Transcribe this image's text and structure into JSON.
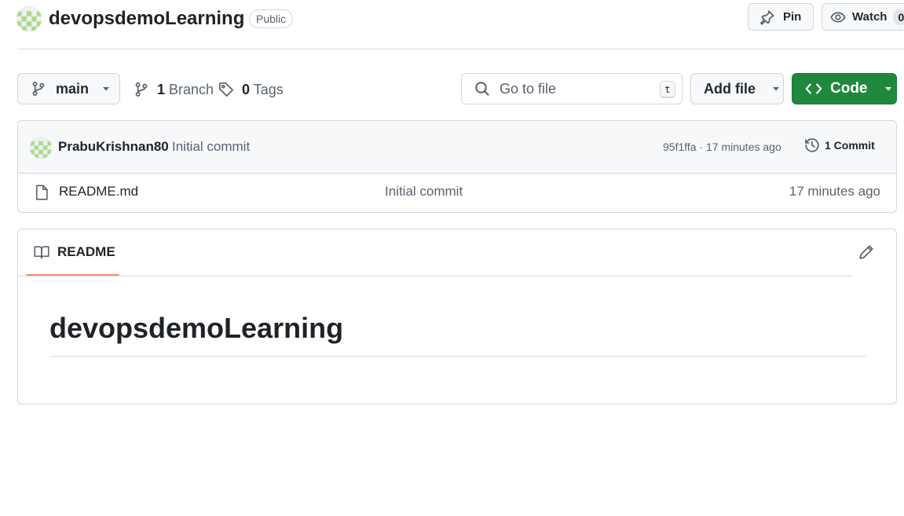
{
  "header": {
    "repo_name": "devopsdemoLearning",
    "visibility": "Public",
    "pin_label": "Pin",
    "watch_label": "Watch",
    "watch_count": "0"
  },
  "toolbar": {
    "branch_name": "main",
    "branches_count": "1",
    "branches_label": "Branch",
    "tags_count": "0",
    "tags_label": "Tags",
    "search_placeholder": "Go to file",
    "search_shortcut": "t",
    "add_file_label": "Add file",
    "code_label": "Code"
  },
  "latest_commit": {
    "author": "PrabuKrishnan80",
    "message": "Initial commit",
    "hash_and_time": "95f1ffa · 17 minutes ago",
    "commits_label": "1 Commit"
  },
  "files": [
    {
      "name": "README.md",
      "commit_message": "Initial commit",
      "age": "17 minutes ago"
    }
  ],
  "readme": {
    "tab_label": "README",
    "heading": "devopsdemoLearning"
  },
  "colors": {
    "code_button": "#1f883d",
    "tab_underline": "#fd8c73",
    "avatar_identicon": "#a8dc8c"
  },
  "icons": [
    "repo-avatar-identicon",
    "pin-icon",
    "eye-icon",
    "git-branch-icon",
    "tag-icon",
    "search-icon",
    "chevron-down-icon",
    "code-icon",
    "history-icon",
    "file-icon",
    "book-icon",
    "pencil-icon"
  ]
}
